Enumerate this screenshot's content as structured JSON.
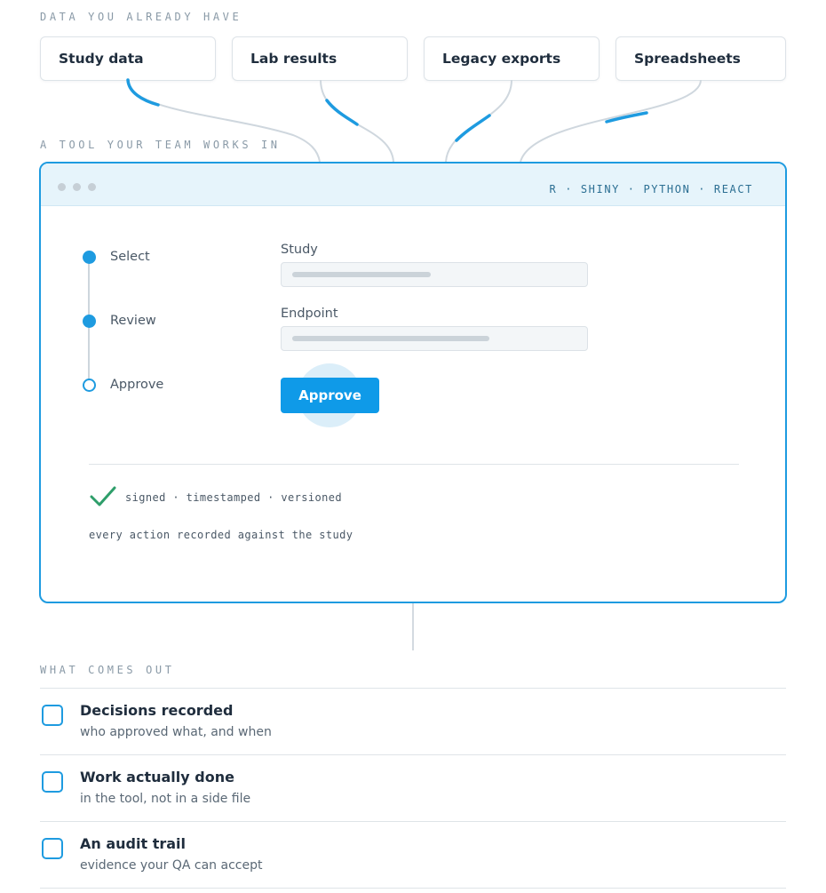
{
  "inputs": {
    "heading": "DATA YOU ALREADY HAVE",
    "sources": [
      {
        "label": "Study data"
      },
      {
        "label": "Lab results"
      },
      {
        "label": "Legacy exports"
      },
      {
        "label": "Spreadsheets"
      }
    ]
  },
  "tool": {
    "heading": "A TOOL YOUR TEAM WORKS IN",
    "tech_stack": "R · SHINY · PYTHON · REACT",
    "steps": [
      {
        "label": "Select",
        "state": "done"
      },
      {
        "label": "Review",
        "state": "done"
      },
      {
        "label": "Approve",
        "state": "current"
      }
    ],
    "fields": {
      "study_label": "Study",
      "endpoint_label": "Endpoint"
    },
    "approve_label": "Approve",
    "status_line": "signed · timestamped · versioned",
    "record_note": "every action recorded against the study"
  },
  "outputs": {
    "heading": "WHAT COMES OUT",
    "items": [
      {
        "title": "Decisions recorded",
        "subtitle": "who approved what, and when"
      },
      {
        "title": "Work actually done",
        "subtitle": "in the tool, not in a side file"
      },
      {
        "title": "An audit trail",
        "subtitle": "evidence your QA can accept"
      }
    ]
  },
  "colors": {
    "accent": "#1e9be0",
    "button": "#0f9ae8",
    "check": "#2e9e6a",
    "connector": "#cfd7de"
  }
}
